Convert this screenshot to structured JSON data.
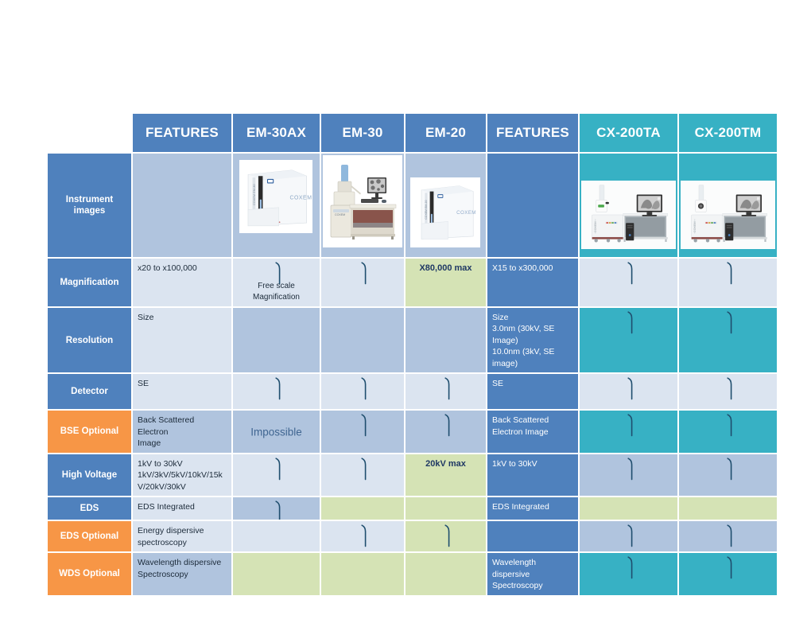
{
  "table": {
    "columns": [
      {
        "key": "rowlabel",
        "header": "",
        "type": "blank"
      },
      {
        "key": "features_left",
        "header": "FEATURES",
        "type": "blue"
      },
      {
        "key": "em30ax",
        "header": "EM-30AX",
        "type": "blue"
      },
      {
        "key": "em30",
        "header": "EM-30",
        "type": "blue"
      },
      {
        "key": "em20",
        "header": "EM-20",
        "type": "blue"
      },
      {
        "key": "features_right",
        "header": "FEATURES",
        "type": "blue"
      },
      {
        "key": "cx200ta",
        "header": "CX-200TA",
        "type": "teal"
      },
      {
        "key": "cx200tm",
        "header": "CX-200TM",
        "type": "teal"
      }
    ],
    "rows": [
      {
        "label": "Instrument\nimages",
        "label_line1": "Instrument",
        "label_line2": "images",
        "label_fill": "blue",
        "cells": [
          {
            "fill": "mid",
            "text": ""
          },
          {
            "fill": "mid",
            "photo": "em30ax-instrument-photo"
          },
          {
            "fill": "mid",
            "photo": "em30-instrument-photo"
          },
          {
            "fill": "mid",
            "photo": "em20-instrument-photo"
          },
          {
            "fill": "blue",
            "text": ""
          },
          {
            "fill": "teal",
            "photo": "cx200ta-instrument-photo"
          },
          {
            "fill": "teal",
            "photo": "cx200tm-instrument-photo"
          }
        ]
      },
      {
        "label": "Magnification",
        "label_fill": "blue",
        "cells": [
          {
            "fill": "light",
            "text": "x20 to x100,000"
          },
          {
            "fill": "light",
            "check": true,
            "note": "Free scale\nMagnification",
            "note1": "Free scale",
            "note2": "Magnification"
          },
          {
            "fill": "light",
            "check": true
          },
          {
            "fill": "green",
            "hilite": "X80,000 max"
          },
          {
            "fill": "blue",
            "text": "X15 to x300,000",
            "onblue": true
          },
          {
            "fill": "light",
            "check": true
          },
          {
            "fill": "light",
            "check": true
          }
        ]
      },
      {
        "label": "Resolution",
        "label_fill": "blue",
        "cells": [
          {
            "fill": "light",
            "text": "Size"
          },
          {
            "fill": "mid"
          },
          {
            "fill": "mid"
          },
          {
            "fill": "mid"
          },
          {
            "fill": "blue",
            "onblue": true,
            "lines": [
              "Size",
              "3.0nm (30kV, SE Image)",
              "10.0nm (3kV, SE image)"
            ]
          },
          {
            "fill": "teal",
            "check": true
          },
          {
            "fill": "teal",
            "check": true
          }
        ]
      },
      {
        "label": "Detector",
        "label_fill": "blue",
        "cells": [
          {
            "fill": "light",
            "text": "SE"
          },
          {
            "fill": "light",
            "check": true
          },
          {
            "fill": "light",
            "check": true
          },
          {
            "fill": "light",
            "check": true
          },
          {
            "fill": "blue",
            "text": "SE",
            "onblue": true
          },
          {
            "fill": "light",
            "check": true
          },
          {
            "fill": "light",
            "check": true
          }
        ]
      },
      {
        "label": "BSE Optional",
        "label_fill": "orange",
        "cells": [
          {
            "fill": "mid",
            "lines": [
              "Back Scattered Electron",
              "Image"
            ]
          },
          {
            "fill": "mid",
            "impossible": "Impossible"
          },
          {
            "fill": "mid",
            "check": true
          },
          {
            "fill": "mid",
            "check": true
          },
          {
            "fill": "blue",
            "onblue": true,
            "lines": [
              "Back Scattered",
              "Electron Image"
            ]
          },
          {
            "fill": "teal",
            "check": true
          },
          {
            "fill": "teal",
            "check": true
          }
        ]
      },
      {
        "label": "High Voltage",
        "label_fill": "blue",
        "cells": [
          {
            "fill": "light",
            "lines": [
              "1kV to 30kV",
              "1kV/3kV/5kV/10kV/15k",
              "V/20kV/30kV"
            ]
          },
          {
            "fill": "light",
            "check": true
          },
          {
            "fill": "light",
            "check": true
          },
          {
            "fill": "green",
            "hilite": "20kV max"
          },
          {
            "fill": "blue",
            "text": "1kV to 30kV",
            "onblue": true
          },
          {
            "fill": "mid",
            "check": true
          },
          {
            "fill": "mid",
            "check": true
          }
        ]
      },
      {
        "label": "EDS",
        "label_fill": "blue",
        "cells": [
          {
            "fill": "light",
            "text": "EDS Integrated"
          },
          {
            "fill": "mid",
            "check": true
          },
          {
            "fill": "green"
          },
          {
            "fill": "green"
          },
          {
            "fill": "blue",
            "text": "EDS Integrated",
            "onblue": true
          },
          {
            "fill": "green"
          },
          {
            "fill": "green"
          }
        ]
      },
      {
        "label": "EDS Optional",
        "label_fill": "orange",
        "cells": [
          {
            "fill": "light",
            "lines": [
              "Energy dispersive",
              "spectroscopy"
            ]
          },
          {
            "fill": "light"
          },
          {
            "fill": "light",
            "check": true
          },
          {
            "fill": "green",
            "check": true
          },
          {
            "fill": "blue"
          },
          {
            "fill": "mid",
            "check": true
          },
          {
            "fill": "mid",
            "check": true
          }
        ]
      },
      {
        "label": "WDS Optional",
        "label_fill": "orange",
        "cells": [
          {
            "fill": "mid",
            "lines": [
              "Wavelength dispersive",
              "Spectroscopy"
            ]
          },
          {
            "fill": "green"
          },
          {
            "fill": "green"
          },
          {
            "fill": "green"
          },
          {
            "fill": "blue",
            "onblue": true,
            "lines": [
              "Wavelength",
              "dispersive",
              "Spectroscopy"
            ]
          },
          {
            "fill": "teal",
            "check": true
          },
          {
            "fill": "teal",
            "check": true
          }
        ]
      }
    ]
  },
  "colors": {
    "header_blue": "#4f81bd",
    "header_teal": "#37b1c4",
    "cell_mid_blue": "#b0c4de",
    "cell_light_blue": "#dbe4f0",
    "cell_green": "#d5e3b5",
    "label_orange": "#f79646",
    "text_dark": "#1c2b3a",
    "check_stroke": "#1f4e6e"
  },
  "photos": {
    "em30ax": {
      "name": "em30ax-instrument-photo",
      "brand": "COXEM",
      "side_label": "COXEM EM-30"
    },
    "em30": {
      "name": "em30-instrument-photo",
      "brand": "COXEM"
    },
    "em20": {
      "name": "em20-instrument-photo",
      "brand": "COXEM",
      "side_label": "COXEM EM-20"
    },
    "cx200ta": {
      "name": "cx200ta-instrument-photo",
      "brand": "COXEM"
    },
    "cx200tm": {
      "name": "cx200tm-instrument-photo",
      "brand": "COXEM"
    }
  }
}
